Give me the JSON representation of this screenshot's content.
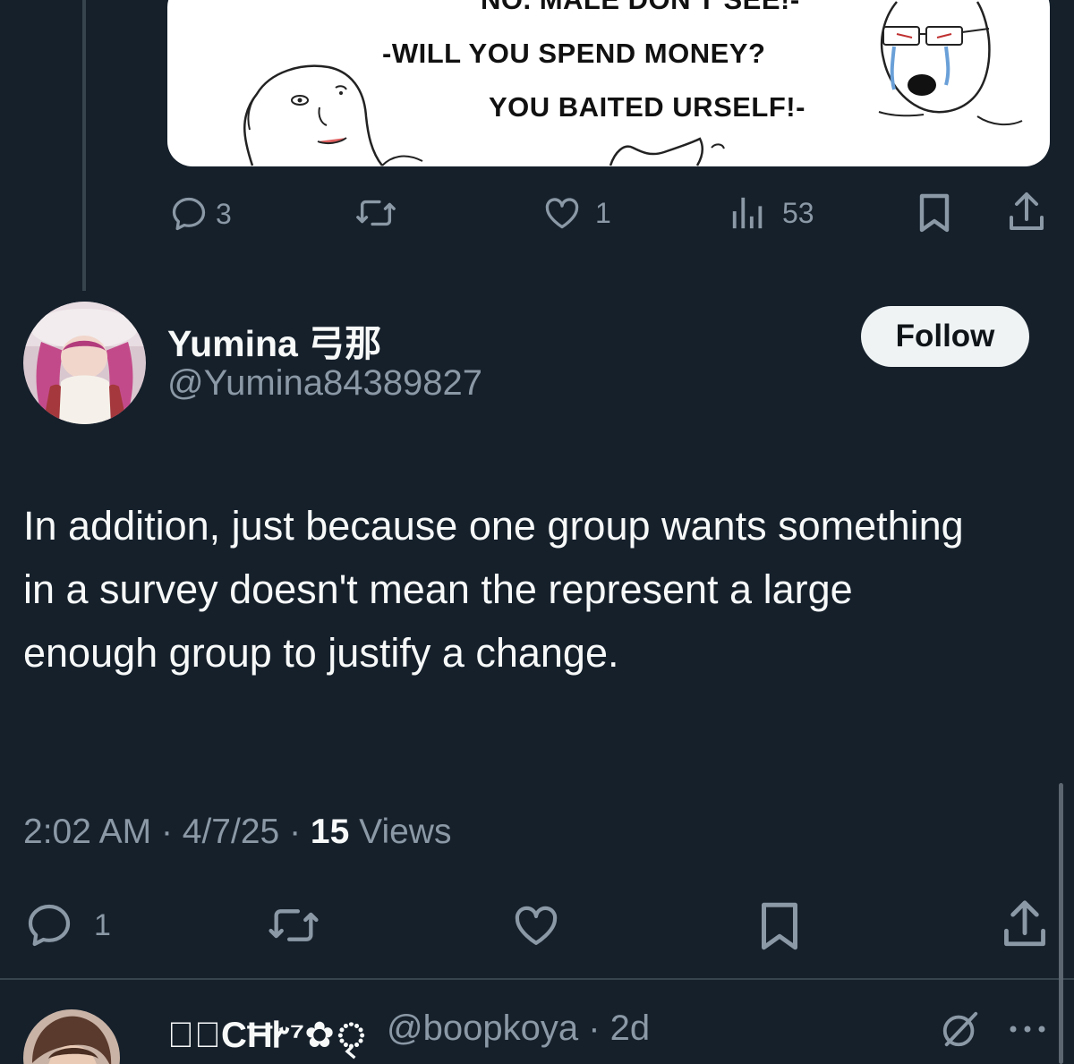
{
  "parent_tweet": {
    "meme": {
      "line_top": "NO. MALE DON'T SEE!-",
      "line_1": "-WILL YOU SPEND MONEY?",
      "line_2": "YOU BAITED URSELF!-"
    },
    "actions": {
      "reply_count": "3",
      "retweet_count": "",
      "like_count": "1",
      "views_count": "53"
    }
  },
  "tweet": {
    "author": {
      "display_name": "Yumina 弓那",
      "handle": "@Yumina84389827"
    },
    "follow_label": "Follow",
    "text": "In addition, just because one group wants something in a survey doesn't mean the represent a large enough group to justify a change.",
    "time": "2:02 AM",
    "date": "4/7/25",
    "views_count": "15",
    "views_label": "Views",
    "separator": "·",
    "actions": {
      "reply_count": "1"
    }
  },
  "reply": {
    "display_name": "✿ৃCĦᎨ⁷✿ৃ",
    "handle": "@boopkoya",
    "separator": "·",
    "age": "2d"
  },
  "colors": {
    "background": "#15202b",
    "text_primary": "#f7f9f9",
    "text_secondary": "#8b98a5",
    "divider": "#38444d",
    "follow_bg": "#eff3f4"
  }
}
